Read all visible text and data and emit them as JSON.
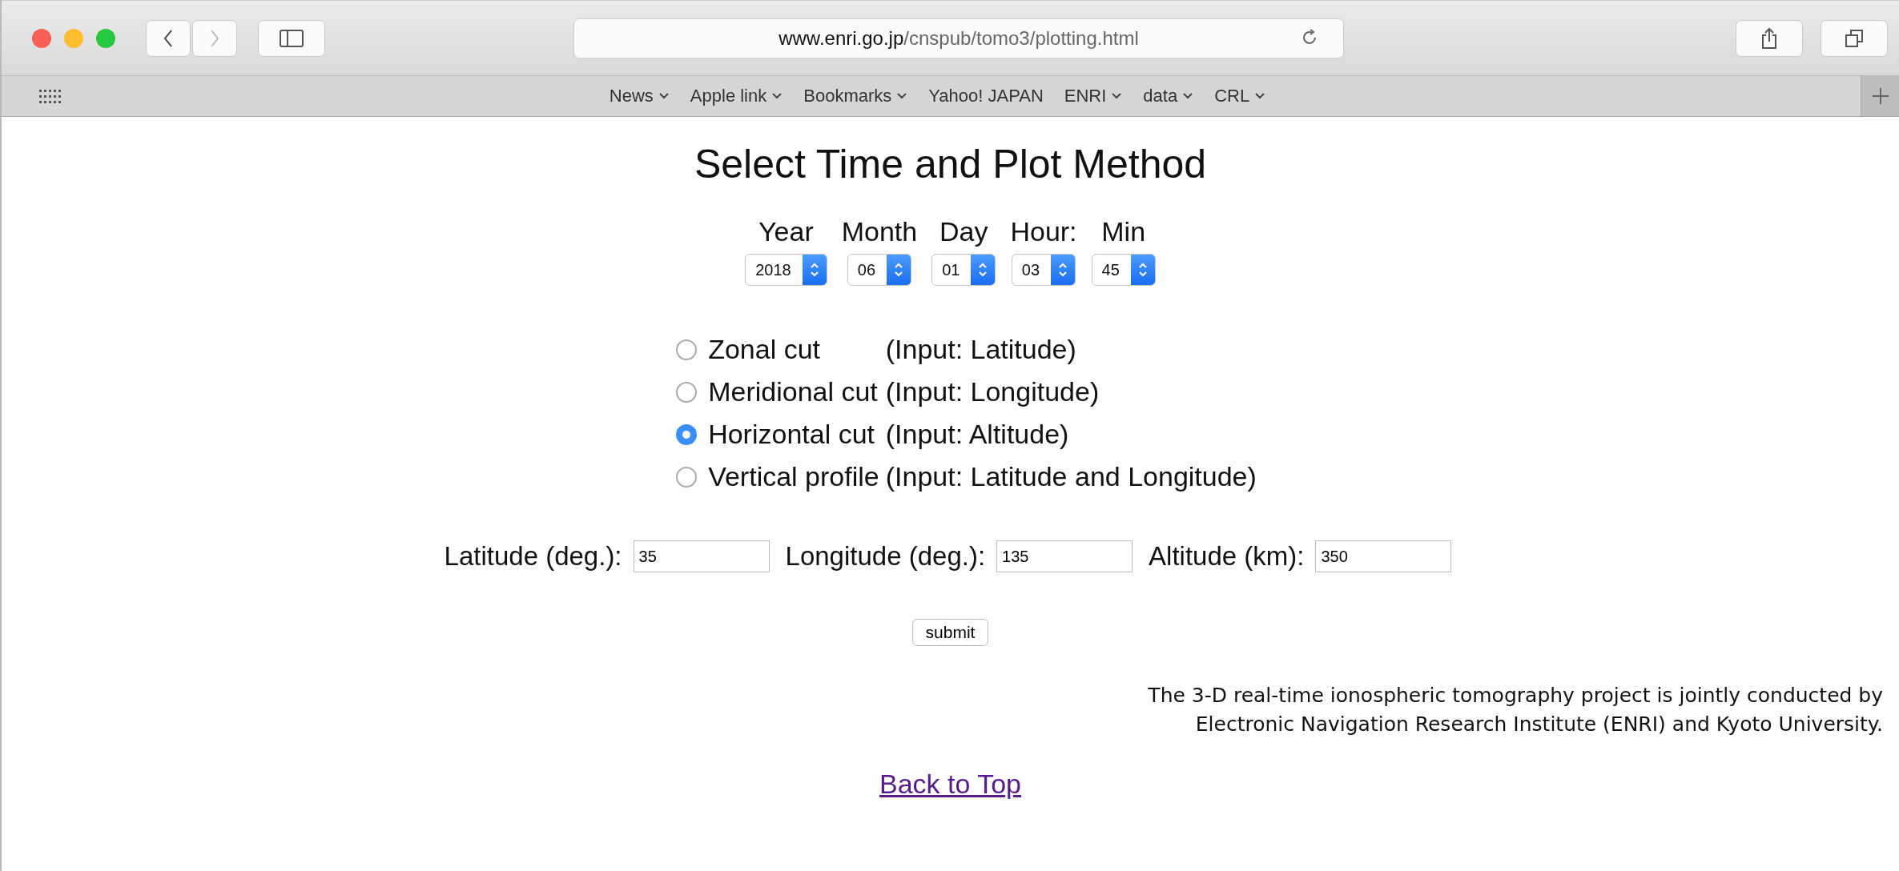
{
  "browser": {
    "url_host": "www.enri.go.jp",
    "url_path": "/cnspub/tomo3/plotting.html"
  },
  "bookmarks": [
    {
      "label": "News",
      "menu": true
    },
    {
      "label": "Apple link",
      "menu": true
    },
    {
      "label": "Bookmarks",
      "menu": true
    },
    {
      "label": "Yahoo! JAPAN",
      "menu": false
    },
    {
      "label": "ENRI",
      "menu": true
    },
    {
      "label": "data",
      "menu": true
    },
    {
      "label": "CRL",
      "menu": true
    }
  ],
  "page": {
    "title": "Select Time and Plot Method",
    "time_selects": [
      {
        "label": "Year",
        "value": "2018"
      },
      {
        "label": "Month",
        "value": "06"
      },
      {
        "label": "Day",
        "value": "01"
      },
      {
        "label": "Hour:",
        "value": "03"
      },
      {
        "label": "Min",
        "value": "45"
      }
    ],
    "methods": [
      {
        "label": "Zonal cut",
        "note": "(Input: Latitude)",
        "selected": false
      },
      {
        "label": "Meridional cut",
        "note": "(Input: Longitude)",
        "selected": false
      },
      {
        "label": "Horizontal cut",
        "note": "(Input: Altitude)",
        "selected": true
      },
      {
        "label": "Vertical profile",
        "note": "(Input: Latitude and Longitude)",
        "selected": false
      }
    ],
    "fields": [
      {
        "label": "Latitude (deg.):",
        "value": "35"
      },
      {
        "label": "Longitude (deg.):",
        "value": "135"
      },
      {
        "label": "Altitude (km):",
        "value": "350"
      }
    ],
    "submit": "submit",
    "credit": [
      "The 3-D real-time ionospheric tomography project is jointly conducted by",
      "Electronic Navigation Research Institute (ENRI) and Kyoto University."
    ],
    "back_link": "Back to Top"
  }
}
